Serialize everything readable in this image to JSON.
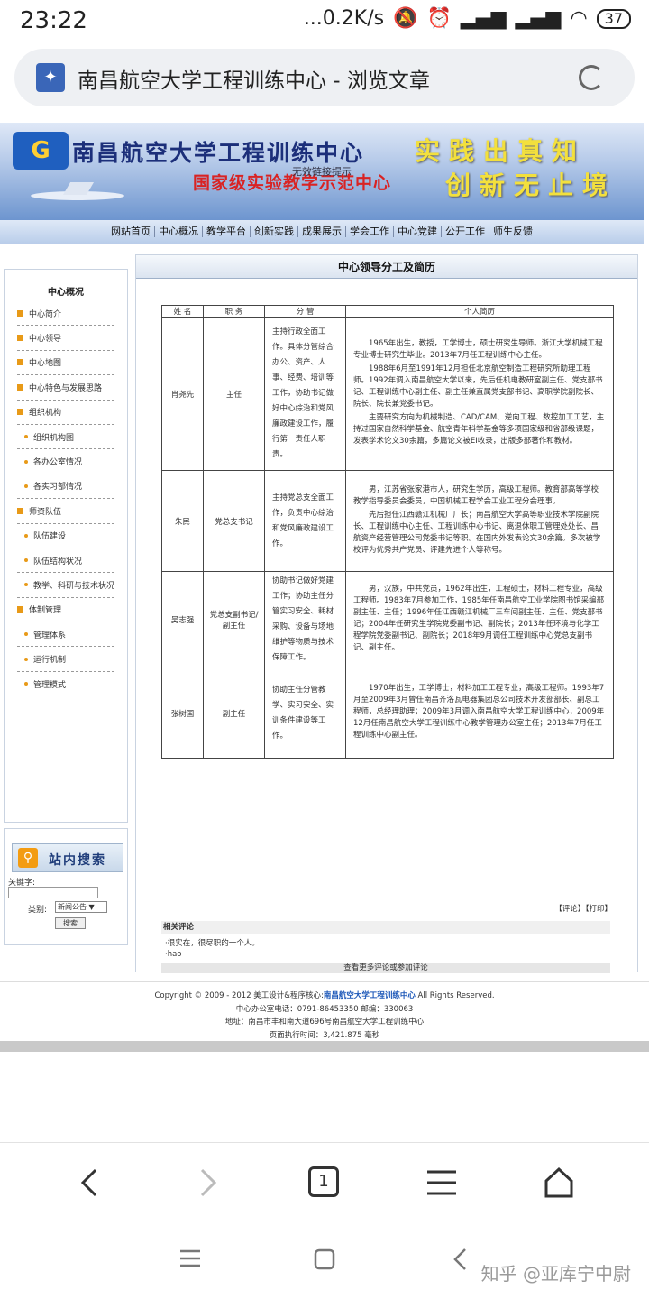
{
  "status_bar": {
    "time": "23:22",
    "net_speed": "...0.2K/s",
    "battery": "37"
  },
  "browser": {
    "page_title": "南昌航空大学工程训练中心 - 浏览文章",
    "tab_count": "1"
  },
  "banner": {
    "site_name": "南昌航空大学工程训练中心",
    "subtitle": "国家级实验教学示范中心",
    "watermark": "无效链接提示",
    "slogan_line1": "实践出真知",
    "slogan_line2": "创新无止境"
  },
  "nav": {
    "items": [
      "网站首页",
      "中心概况",
      "教学平台",
      "创新实践",
      "成果展示",
      "学会工作",
      "中心党建",
      "公开工作",
      "师生反馈"
    ]
  },
  "sidebar": {
    "heading": "中心概况",
    "items": [
      {
        "label": "中心简介",
        "level": 1
      },
      {
        "label": "中心领导",
        "level": 1
      },
      {
        "label": "中心地图",
        "level": 1
      },
      {
        "label": "中心特色与发展思路",
        "level": 1
      },
      {
        "label": "组织机构",
        "level": 1
      },
      {
        "label": "组织机构图",
        "level": 2
      },
      {
        "label": "各办公室情况",
        "level": 2
      },
      {
        "label": "各实习部情况",
        "level": 2
      },
      {
        "label": "师资队伍",
        "level": 1
      },
      {
        "label": "队伍建设",
        "level": 2
      },
      {
        "label": "队伍结构状况",
        "level": 2
      },
      {
        "label": "教学、科研与技术状况",
        "level": 2
      },
      {
        "label": "体制管理",
        "level": 1
      },
      {
        "label": "管理体系",
        "level": 2
      },
      {
        "label": "运行机制",
        "level": 2
      },
      {
        "label": "管理模式",
        "level": 2
      }
    ]
  },
  "search": {
    "title": "站内搜索",
    "keyword_label": "关键字:",
    "keyword_value": "",
    "category_label": "类别:",
    "category_selected": "新闻公告",
    "button": "搜索"
  },
  "main": {
    "heading": "中心领导分工及简历",
    "table": {
      "headers": [
        "姓 名",
        "职 务",
        "分 管",
        "个人简历"
      ],
      "rows": [
        {
          "name": "肖尧先",
          "position": "主任",
          "duty": "主持行政全面工作。具体分管综合办公、资产、人事、经费、培训等工作，协助书记做好中心综治和党风廉政建设工作，履行第一责任人职责。",
          "bio": [
            "1965年出生，教授，工学博士，硕士研究生导师。浙江大学机械工程专业博士研究生毕业。2013年7月任工程训练中心主任。",
            "1988年6月至1991年12月担任北京航空制造工程研究所助理工程师。1992年调入南昌航空大学以来，先后任机电教研室副主任、党支部书记、工程训练中心副主任、副主任兼直属党支部书记、高职学院副院长、院长、院长兼党委书记。",
            "主要研究方向为机械制造、CAD/CAM、逆向工程、数控加工工艺，主持过国家自然科学基金、航空青年科学基金等多项国家级和省部级课题，发表学术论文30余篇，多篇论文被EI收录，出版多部著作和教材。"
          ]
        },
        {
          "name": "朱民",
          "position": "党总支书记",
          "duty": "主持党总支全面工作，负责中心综治和党风廉政建设工作。",
          "bio": [
            "男，江苏省张家港市人，研究生学历，高级工程师。教育部高等学校教学指导委员会委员，中国机械工程学会工业工程分会理事。",
            "先后担任江西赣江机械厂厂长；南昌航空大学高等职业技术学院副院长、工程训练中心主任、工程训练中心书记、离退休职工管理处处长、昌航资产经营管理公司党委书记等职。在国内外发表论文30余篇。多次被学校评为优秀共产党员、评建先进个人等称号。"
          ]
        },
        {
          "name": "吴志强",
          "position": "党总支副书记/副主任",
          "duty": "协助书记做好党建工作；协助主任分管实习安全、耗材采购、设备与场地维护等物质与技术保障工作。",
          "bio": [
            "男，汉族，中共党员，1962年出生，工程硕士，材料工程专业，高级工程师。1983年7月参加工作，1985年任南昌航空工业学院图书馆采编部副主任、主任；1996年任江西赣江机械厂三车间副主任、主任、党支部书记；2004年任研究生学院党委副书记、副院长；2013年任环境与化学工程学院党委副书记、副院长；2018年9月调任工程训练中心党总支副书记、副主任。"
          ]
        },
        {
          "name": "张树国",
          "position": "副主任",
          "duty": "协助主任分管教学、实习安全、实训条件建设等工作。",
          "bio": [
            "1970年出生，工学博士，材料加工工程专业，高级工程师。1993年7月至2009年3月曾任南昌齐洛瓦电器集团总公司技术开发部部长、副总工程师，总经理助理；2009年3月调入南昌航空大学工程训练中心，2009年12月任南昌航空大学工程训练中心教学管理办公室主任；2013年7月任工程训练中心副主任。"
          ]
        }
      ]
    },
    "links": "【评论】【打印】",
    "related_title": "相关评论",
    "comments": [
      "·很实在，很尽职的一个人。",
      "·hao"
    ],
    "more_comments": "查看更多评论或参加评论"
  },
  "footer": {
    "copyright_pre": "Copyright © 2009 - 2012 美工设计&程序核心:",
    "copyright_org": "南昌航空大学工程训练中心",
    "copyright_post": " All Rights Reserved.",
    "contact": "中心办公室电话：0791-86453350 邮编：330063",
    "address": "地址：南昌市丰和南大道696号南昌航空大学工程训练中心",
    "exec_time": "页面执行时间：3,421.875 毫秒"
  },
  "watermark": "知乎 @亚库宁中尉"
}
